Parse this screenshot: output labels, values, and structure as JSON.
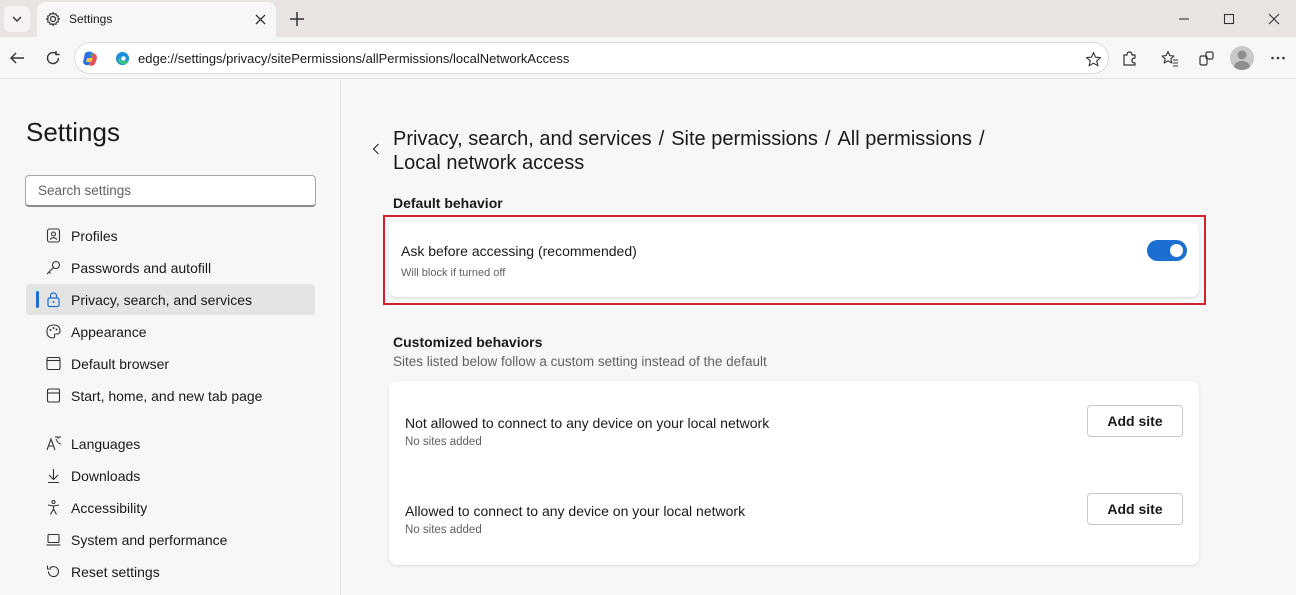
{
  "browser": {
    "tab": {
      "title": "Settings",
      "icon": "gear-icon"
    },
    "address": {
      "url": "edge://settings/privacy/sitePermissions/allPermissions/localNetworkAccess"
    }
  },
  "sidebar": {
    "title": "Settings",
    "search_placeholder": "Search settings",
    "items": [
      {
        "label": "Profiles",
        "icon": "profile-icon"
      },
      {
        "label": "Passwords and autofill",
        "icon": "key-icon"
      },
      {
        "label": "Privacy, search, and services",
        "icon": "lock-icon",
        "active": true
      },
      {
        "label": "Appearance",
        "icon": "palette-icon"
      },
      {
        "label": "Default browser",
        "icon": "browser-icon"
      },
      {
        "label": "Start, home, and new tab page",
        "icon": "home-page-icon"
      },
      {
        "label": "Languages",
        "icon": "languages-icon"
      },
      {
        "label": "Downloads",
        "icon": "download-icon"
      },
      {
        "label": "Accessibility",
        "icon": "accessibility-icon"
      },
      {
        "label": "System and performance",
        "icon": "laptop-icon"
      },
      {
        "label": "Reset settings",
        "icon": "reset-icon"
      }
    ]
  },
  "main": {
    "breadcrumb": [
      "Privacy, search, and services",
      "Site permissions",
      "All permissions",
      "Local network access"
    ],
    "default_behavior": {
      "heading": "Default behavior",
      "title": "Ask before accessing (recommended)",
      "subtitle": "Will block if turned off",
      "toggle_on": true
    },
    "customized": {
      "heading": "Customized behaviors",
      "subtitle": "Sites listed below follow a custom setting instead of the default",
      "rows": [
        {
          "title": "Not allowed to connect to any device on your local network",
          "subtitle": "No sites added",
          "button": "Add site"
        },
        {
          "title": "Allowed to connect to any device on your local network",
          "subtitle": "No sites added",
          "button": "Add site"
        }
      ]
    }
  },
  "colors": {
    "accent": "#1c6fd1",
    "highlight": "#d4202c"
  }
}
